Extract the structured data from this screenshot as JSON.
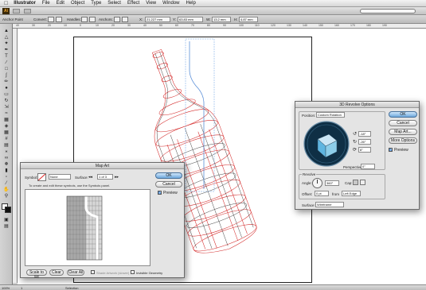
{
  "menubar": {
    "apple": "",
    "app_name": "Illustrator",
    "items": [
      "File",
      "Edit",
      "Object",
      "Type",
      "Select",
      "Effect",
      "View",
      "Window",
      "Help"
    ]
  },
  "appbar": {
    "logo": "Ai"
  },
  "control_bar": {
    "selection_label": "Anchor Point",
    "convert_label": "Convert:",
    "handles_label": "Handles:",
    "anchors_label": "Anchors:",
    "x_value": "21.227 mm",
    "y_value": "63.83 mm",
    "w_value": "13.2 mm",
    "h_value": "4.87 mm"
  },
  "ruler": {
    "ticks": [
      "40",
      "30",
      "20",
      "10",
      "0",
      "10",
      "20",
      "30",
      "40",
      "50",
      "60",
      "70",
      "80",
      "90",
      "100",
      "110",
      "120",
      "130",
      "140",
      "150",
      "160",
      "170",
      "180",
      "190"
    ]
  },
  "status_bar": {
    "zoom": "100%",
    "page": "1",
    "info": "Selection"
  },
  "map_art": {
    "title": "Map Art",
    "symbol_label": "Symbol:",
    "symbol_value": "None",
    "surface_label": "Surface:",
    "surface_value": "1 of 3",
    "hint": "To create and edit these symbols, use the Symbols panel.",
    "ok": "OK",
    "cancel": "Cancel",
    "preview_label": "Preview",
    "preview_checked": true,
    "scale_to_fit": "Scale to Fit",
    "clear": "Clear",
    "clear_all": "Clear All",
    "shade_artwork_label": "Shade Artwork (slower)",
    "invisible_geometry_label": "Invisible Geometry"
  },
  "revolve": {
    "title": "3D Revolve Options",
    "position_label": "Position:",
    "position_value": "Custom Rotation",
    "rot_x": "-18°",
    "rot_y": "-26°",
    "rot_z": "8°",
    "perspective_label": "Perspective:",
    "perspective_value": "0°",
    "ok": "OK",
    "cancel": "Cancel",
    "map_art": "Map Art...",
    "more_options": "More Options",
    "preview_label": "Preview",
    "preview_checked": true,
    "revolve_section": "Revolve",
    "angle_label": "Angle:",
    "angle_value": "360°",
    "cap_label": "Cap:",
    "offset_label": "Offset:",
    "offset_value": "0 pt",
    "from_label": "from",
    "from_value": "Left Edge",
    "surface_label": "Surface:",
    "surface_value": "Wireframe"
  }
}
